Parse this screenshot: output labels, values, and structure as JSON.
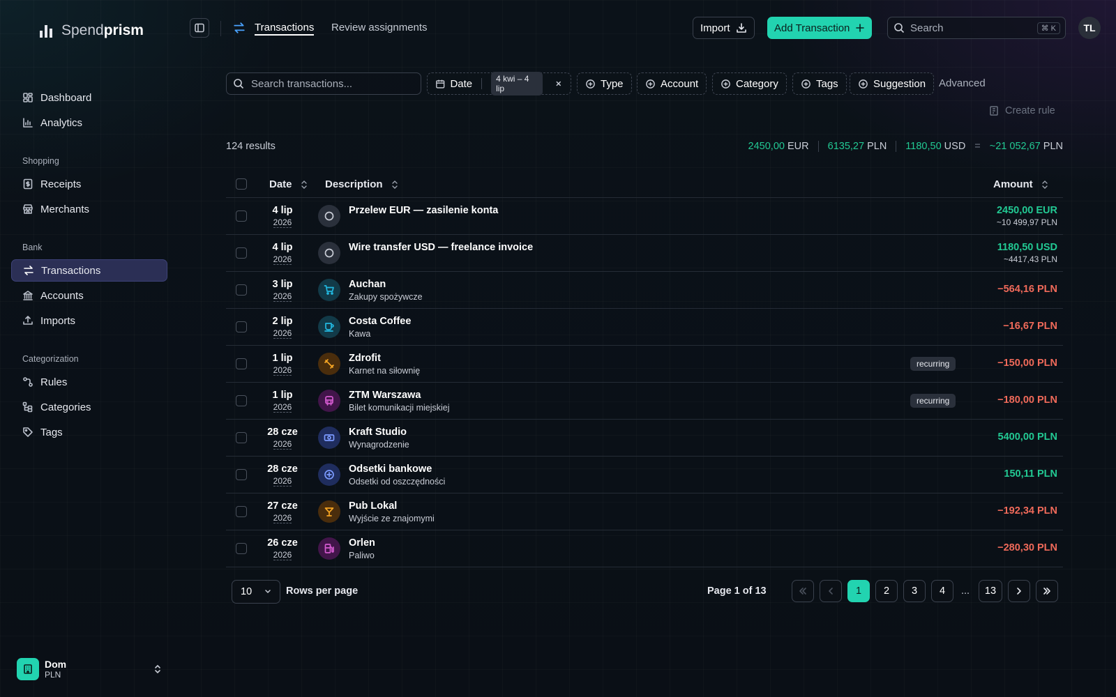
{
  "app": {
    "brand_light": "Spend",
    "brand_bold": "prism"
  },
  "sidebar": {
    "items": [
      {
        "label": "Dashboard",
        "icon": "dashboard-icon"
      },
      {
        "label": "Analytics",
        "icon": "bar-chart-icon"
      },
      {
        "label": "Receipts",
        "icon": "receipt-icon"
      },
      {
        "label": "Merchants",
        "icon": "store-icon"
      },
      {
        "label": "Transactions",
        "icon": "arrows-exchange-icon",
        "active": true
      },
      {
        "label": "Accounts",
        "icon": "bank-icon"
      },
      {
        "label": "Imports",
        "icon": "upload-icon"
      },
      {
        "label": "Rules",
        "icon": "rules-icon"
      },
      {
        "label": "Categories",
        "icon": "categories-icon"
      },
      {
        "label": "Tags",
        "icon": "tag-icon"
      }
    ],
    "sections": [
      "Shopping",
      "Bank",
      "Categorization"
    ],
    "workspace": {
      "name": "Dom",
      "currency": "PLN"
    }
  },
  "header": {
    "tabs": [
      "Transactions",
      "Review assignments"
    ],
    "import_label": "Import",
    "add_label": "Add Transaction",
    "search_placeholder": "Search",
    "shortcut": "⌘ K",
    "avatar": "TL"
  },
  "filters": {
    "search_placeholder": "Search transactions...",
    "date_label": "Date",
    "date_range": "4 kwi – 4 lip",
    "type_label": "Type",
    "account_label": "Account",
    "category_label": "Category",
    "tags_label": "Tags",
    "suggestion_label": "Suggestion",
    "advanced_label": "Advanced",
    "create_rule_label": "Create rule"
  },
  "summary": {
    "results": "124 results",
    "totals": [
      {
        "amount": "2450,00",
        "currency": "EUR"
      },
      {
        "amount": "6135,27",
        "currency": "PLN"
      },
      {
        "amount": "1180,50",
        "currency": "USD"
      }
    ],
    "equals": "=",
    "grand_prefix": "~",
    "grand_amount": "21 052,67",
    "grand_currency": "PLN"
  },
  "table": {
    "columns": {
      "date": "Date",
      "description": "Description",
      "amount": "Amount"
    },
    "rows": [
      {
        "day": "4 lip",
        "year": "2026",
        "title": "Przelew EUR — zasilenie konta",
        "subtitle": "",
        "icon": "circle-icon",
        "amount": "2450,00 EUR",
        "sub_amount": "~10 499,97 PLN",
        "positive": true,
        "badge": ""
      },
      {
        "day": "4 lip",
        "year": "2026",
        "title": "Wire transfer USD — freelance invoice",
        "subtitle": "",
        "icon": "circle-icon",
        "amount": "1180,50 USD",
        "sub_amount": "~4417,43 PLN",
        "positive": true,
        "badge": ""
      },
      {
        "day": "3 lip",
        "year": "2026",
        "title": "Auchan",
        "subtitle": "Zakupy spożywcze",
        "icon": "cart-icon",
        "amount": "−564,16 PLN",
        "sub_amount": "",
        "positive": false,
        "badge": ""
      },
      {
        "day": "2 lip",
        "year": "2026",
        "title": "Costa Coffee",
        "subtitle": "Kawa",
        "icon": "coffee-icon",
        "amount": "−16,67 PLN",
        "sub_amount": "",
        "positive": false,
        "badge": ""
      },
      {
        "day": "1 lip",
        "year": "2026",
        "title": "Zdrofit",
        "subtitle": "Karnet na siłownię",
        "icon": "dumbbell-icon",
        "amount": "−150,00 PLN",
        "sub_amount": "",
        "positive": false,
        "badge": "recurring"
      },
      {
        "day": "1 lip",
        "year": "2026",
        "title": "ZTM Warszawa",
        "subtitle": "Bilet komunikacji miejskiej",
        "icon": "bus-icon",
        "amount": "−180,00 PLN",
        "sub_amount": "",
        "positive": false,
        "badge": "recurring"
      },
      {
        "day": "28 cze",
        "year": "2026",
        "title": "Kraft Studio",
        "subtitle": "Wynagrodzenie",
        "icon": "banknote-icon",
        "amount": "5400,00 PLN",
        "sub_amount": "",
        "positive": true,
        "badge": ""
      },
      {
        "day": "28 cze",
        "year": "2026",
        "title": "Odsetki bankowe",
        "subtitle": "Odsetki od oszczędności",
        "icon": "plus-circle-icon",
        "amount": "150,11 PLN",
        "sub_amount": "",
        "positive": true,
        "badge": ""
      },
      {
        "day": "27 cze",
        "year": "2026",
        "title": "Pub Lokal",
        "subtitle": "Wyjście ze znajomymi",
        "icon": "cocktail-icon",
        "amount": "−192,34 PLN",
        "sub_amount": "",
        "positive": false,
        "badge": ""
      },
      {
        "day": "26 cze",
        "year": "2026",
        "title": "Orlen",
        "subtitle": "Paliwo",
        "icon": "fuel-icon",
        "amount": "−280,30 PLN",
        "sub_amount": "",
        "positive": false,
        "badge": ""
      }
    ]
  },
  "pagination": {
    "rows_per_page": "10",
    "rows_label": "Rows per page",
    "page_text": "Page 1 of 13",
    "pages": [
      "1",
      "2",
      "3",
      "4"
    ],
    "ellipsis": "...",
    "last": "13"
  },
  "colors": {
    "accent": "#22d3b0",
    "positive": "#22c993",
    "negative": "#f06a5a",
    "active_nav": "#2b2f55"
  }
}
